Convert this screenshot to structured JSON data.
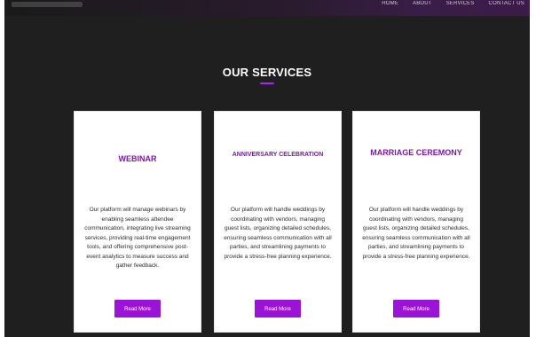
{
  "nav": {
    "items": [
      "HOME",
      "ABOUT",
      "SERVICES",
      "CONTACT US"
    ]
  },
  "services": {
    "title": "OUR SERVICES",
    "cards": [
      {
        "title": "WEBINAR",
        "description": "Our platform will manage webinars by enabling seamless attendee communication, integrating live streaming services, providing real-time engagement tools, and offering comprehensive post-event analytics to measure success and gather feedback.",
        "button_label": "Read More"
      },
      {
        "title": "ANNIVERSARY CELEBRATION",
        "description": "Our platform will handle weddings by coordinating with vendors, managing guest lists, organizing detailed schedules, ensuring seamless communication with all parties, and streamlining payments to provide a stress-free planning experience.",
        "button_label": "Read More"
      },
      {
        "title": "MARRIAGE CEREMONY",
        "description": "Our platform will handle weddings by coordinating with vendors, managing guest lists, organizing detailed schedules, ensuring seamless communication with all parties, and streamlining payments to provide a stress-free planning experience.",
        "button_label": "Read More"
      }
    ]
  },
  "colors": {
    "background": "#1f1f1f",
    "accent": "#9b13d6",
    "title_purple": "#7d15b3",
    "card_bg": "#ffffff"
  }
}
